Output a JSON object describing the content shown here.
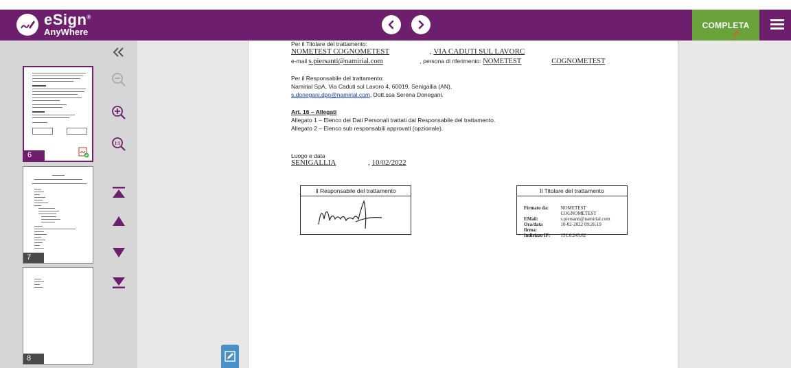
{
  "header": {
    "logo_line1": "eSign",
    "logo_reg": "®",
    "logo_line2": "AnyWhere",
    "complete_label": "COMPLETA"
  },
  "thumbnails": [
    {
      "page": "6"
    },
    {
      "page": "7"
    },
    {
      "page": "8"
    }
  ],
  "document": {
    "titolare_heading": "Per il Titolare del trattamento:",
    "titolare_name": "NOMETEST COGNOMETEST",
    "titolare_address": "VIA CADUTI SUL LAVORC",
    "email_label": "e-mail",
    "email_value": "s.piersanti@namirial.com",
    "ref_label": "persona di riferimento:",
    "ref_first": "NOMETEST",
    "ref_last": "COGNOMETEST",
    "responsabile_heading": "Per il Responsabile del trattamento:",
    "responsabile_line": "Namirial SpA, Via Caduti sul Lavoro 4, 60019, Senigallia (AN),",
    "dpo_email": "s.donegani.dpo@namirial.com",
    "dpo_name": ", Dott.ssa Serena Donegani.",
    "art_title": "Art. 16 – Allegati",
    "allegato1": "Allegato 1 – Elenco dei Dati Personali trattati dal Responsabile del trattamento.",
    "allegato2": "Allegato 2 – Elenco sub responsabili approvati (opzionale).",
    "place_label": "Luogo e data",
    "place_value": "SENIGALLIA",
    "date_value": "10/02/2022",
    "box_responsabile": "Il Responsabile del trattamento",
    "box_titolare": "Il Titolare del trattamento",
    "stamp": {
      "signed_by_label": "Firmato da:",
      "signed_by_value": "NOMETEST COGNOMETEST",
      "email_label": "EMail:",
      "email_value": "s.piersanti@namirial.com",
      "date_label": "Ora/data firma:",
      "date_value": "10-02-2022 09:26:19",
      "ip_label": "Indirizzo IP:",
      "ip_value": "151.0.245.62"
    }
  },
  "colors": {
    "brand": "#6d1f6e",
    "complete": "#6aa33c",
    "sign_button": "#4a8fc6"
  }
}
